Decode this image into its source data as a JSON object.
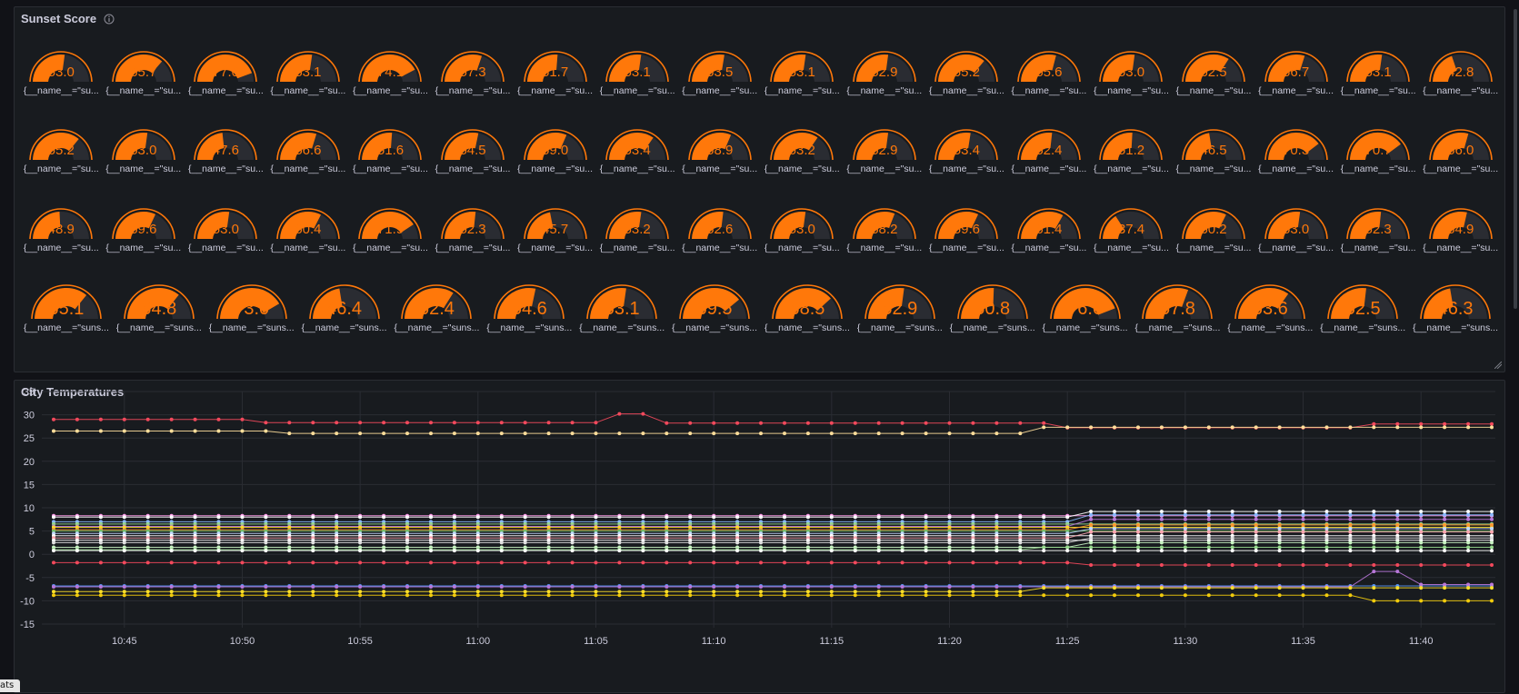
{
  "gauge_panel": {
    "title": "Sunset Score",
    "info_icon": "info-circle-icon",
    "accent_color": "#ff780a",
    "track_color": "#2a2c32",
    "min": 0,
    "max": 100,
    "label_short": "{__name__=\"su...",
    "label_long": "{__name__=\"suns...",
    "rows": [
      [
        53.0,
        65.7,
        77.0,
        53.1,
        74.1,
        57.3,
        51.7,
        53.1,
        53.5,
        53.1,
        52.9,
        65.2,
        55.6,
        53.0,
        62.5,
        56.7,
        53.1,
        42.8
      ],
      [
        65.2,
        53.0,
        47.6,
        56.6,
        51.6,
        54.5,
        59.0,
        63.4,
        58.9,
        63.2,
        52.9,
        53.4,
        52.4,
        51.2,
        46.5,
        70.3,
        70.7,
        56.0
      ],
      [
        48.9,
        59.6,
        53.0,
        60.4,
        71.9,
        52.3,
        45.7,
        53.2,
        52.6,
        53.0,
        58.2,
        59.6,
        61.4,
        37.4,
        60.2,
        53.0,
        52.3,
        54.9
      ],
      [
        65.1,
        64.8,
        73.0,
        46.4,
        62.4,
        54.6,
        53.1,
        69.5,
        68.5,
        52.9,
        50.8,
        76.6,
        57.8,
        63.6,
        52.5,
        46.3
      ]
    ]
  },
  "temp_panel": {
    "title": "City Temperatures",
    "stats_tab": "ats",
    "chart_data": {
      "type": "line",
      "y_ticks": [
        "35",
        "30",
        "25",
        "20",
        "15",
        "10",
        "5",
        "0",
        "-5",
        "-10",
        "-15"
      ],
      "ylim": [
        -15,
        35
      ],
      "x_ticks": [
        "10:45",
        "10:50",
        "10:55",
        "11:00",
        "11:05",
        "11:10",
        "11:15",
        "11:20",
        "11:25",
        "11:30",
        "11:35",
        "11:40"
      ],
      "x_range_minutes": [
        "10:42",
        "11:43"
      ],
      "grid": true,
      "point_interval_minutes": 1,
      "series": [
        {
          "color": "#f2495c",
          "segments": [
            [
              0,
              29.0
            ],
            [
              8,
              29.0
            ],
            [
              9,
              28.3
            ],
            [
              23,
              28.3
            ],
            [
              24,
              30.2
            ],
            [
              25,
              30.2
            ],
            [
              26,
              28.2
            ],
            [
              41,
              28.2
            ],
            [
              42,
              28.2
            ],
            [
              43,
              27.2
            ],
            [
              55,
              27.2
            ],
            [
              56,
              28.0
            ],
            [
              61,
              28.0
            ]
          ]
        },
        {
          "color": "#fcdd9a",
          "segments": [
            [
              0,
              26.5
            ],
            [
              9,
              26.5
            ],
            [
              10,
              26.0
            ],
            [
              41,
              26.0
            ],
            [
              42,
              27.3
            ],
            [
              61,
              27.3
            ]
          ]
        },
        {
          "color": "#ff99ea",
          "segments": [
            [
              0,
              8.3
            ],
            [
              61,
              8.3
            ]
          ]
        },
        {
          "color": "#ffffff",
          "segments": [
            [
              0,
              8.0
            ],
            [
              43,
              8.0
            ],
            [
              44,
              9.2
            ],
            [
              61,
              9.2
            ]
          ]
        },
        {
          "color": "#8ab8ff",
          "segments": [
            [
              0,
              7.0
            ],
            [
              43,
              7.0
            ],
            [
              44,
              8.5
            ],
            [
              61,
              8.5
            ]
          ]
        },
        {
          "color": "#96d98d",
          "segments": [
            [
              0,
              6.5
            ],
            [
              61,
              6.5
            ]
          ]
        },
        {
          "color": "#b877d9",
          "segments": [
            [
              0,
              6.0
            ],
            [
              43,
              6.0
            ],
            [
              44,
              7.5
            ],
            [
              61,
              7.5
            ]
          ]
        },
        {
          "color": "#fade2a",
          "segments": [
            [
              0,
              5.8
            ],
            [
              61,
              5.8
            ]
          ]
        },
        {
          "color": "#ff9830",
          "segments": [
            [
              0,
              5.3
            ],
            [
              43,
              5.3
            ],
            [
              44,
              6.3
            ],
            [
              61,
              6.3
            ]
          ]
        },
        {
          "color": "#73bf69",
          "segments": [
            [
              0,
              5.0
            ],
            [
              61,
              5.0
            ]
          ]
        },
        {
          "color": "#c0d8ff",
          "segments": [
            [
              0,
              4.5
            ],
            [
              43,
              4.5
            ],
            [
              44,
              5.5
            ],
            [
              61,
              5.5
            ]
          ]
        },
        {
          "color": "#ffffff",
          "segments": [
            [
              0,
              4.0
            ],
            [
              61,
              4.0
            ]
          ]
        },
        {
          "color": "#ffa6b0",
          "segments": [
            [
              0,
              3.5
            ],
            [
              43,
              3.5
            ],
            [
              44,
              4.8
            ],
            [
              61,
              4.8
            ]
          ]
        },
        {
          "color": "#ffffff",
          "segments": [
            [
              0,
              3.0
            ],
            [
              61,
              3.0
            ]
          ]
        },
        {
          "color": "#e0e0e0",
          "segments": [
            [
              0,
              2.5
            ],
            [
              43,
              2.5
            ],
            [
              44,
              3.5
            ],
            [
              61,
              3.5
            ]
          ]
        },
        {
          "color": "#c8f2c2",
          "segments": [
            [
              0,
              1.5
            ],
            [
              43,
              1.5
            ],
            [
              44,
              2.5
            ],
            [
              61,
              2.5
            ]
          ]
        },
        {
          "color": "#96d98d",
          "segments": [
            [
              0,
              1.0
            ],
            [
              41,
              1.0
            ],
            [
              42,
              1.5
            ],
            [
              61,
              1.5
            ]
          ]
        },
        {
          "color": "#ffffff",
          "segments": [
            [
              0,
              0.8
            ],
            [
              61,
              0.8
            ]
          ]
        },
        {
          "color": "#f2495c",
          "segments": [
            [
              0,
              -1.8
            ],
            [
              43,
              -1.8
            ],
            [
              44,
              -2.3
            ],
            [
              61,
              -2.3
            ]
          ]
        },
        {
          "color": "#5794f2",
          "segments": [
            [
              0,
              -6.8
            ],
            [
              61,
              -6.8
            ]
          ]
        },
        {
          "color": "#b877d9",
          "segments": [
            [
              0,
              -7.0
            ],
            [
              55,
              -7.0
            ],
            [
              56,
              -3.7
            ],
            [
              57,
              -3.7
            ],
            [
              58,
              -6.5
            ],
            [
              61,
              -6.5
            ]
          ]
        },
        {
          "color": "#fade2a",
          "segments": [
            [
              0,
              -8.0
            ],
            [
              41,
              -8.0
            ],
            [
              42,
              -7.2
            ],
            [
              61,
              -7.2
            ]
          ]
        },
        {
          "color": "#f2cc0c",
          "segments": [
            [
              0,
              -8.8
            ],
            [
              55,
              -8.8
            ],
            [
              56,
              -10.0
            ],
            [
              61,
              -10.0
            ]
          ]
        }
      ]
    }
  }
}
